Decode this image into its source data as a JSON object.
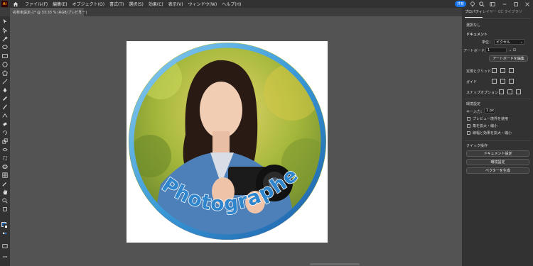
{
  "app": {
    "logo": "Ai",
    "accent": "#ff9a00"
  },
  "menu": [
    "ファイル(F)",
    "編集(E)",
    "オブジェクト(O)",
    "書式(T)",
    "選択(S)",
    "効果(C)",
    "表示(V)",
    "ウィンドウ(W)",
    "ヘルプ(H)"
  ],
  "topbar": {
    "share_label": "共有"
  },
  "document": {
    "tab_title": "名称未設定-1* @ 33.33 % (RGB/プレビュー)",
    "close": "×"
  },
  "artwork": {
    "text": "Photographer"
  },
  "panel": {
    "tabs": [
      "プロパティ",
      "レイヤー",
      "CC ライブラリ"
    ],
    "selection": "選択なし",
    "document_heading": "ドキュメント",
    "unit_label": "単位：",
    "unit_value": "ピクセル",
    "artboard_label": "アートボード：",
    "artboard_value": "1",
    "edit_artboard": "アートボードを編集",
    "rulers_grid": "定規とグリッド",
    "guides": "ガイド",
    "snap_options": "スナップオプション",
    "preferences_heading": "環境設定",
    "key_increment_label": "キー入力：",
    "key_increment_value": "1 px",
    "opt_preview_bounds": "プレビュー境界を使用",
    "opt_scale_corners": "角を拡大・縮小",
    "opt_scale_strokes": "線幅と効果を拡大・縮小",
    "quick_actions_heading": "クイック操作",
    "doc_settings": "ドキュメント設定",
    "preferences_btn": "環境設定",
    "vectorize": "ベクターを生成"
  }
}
